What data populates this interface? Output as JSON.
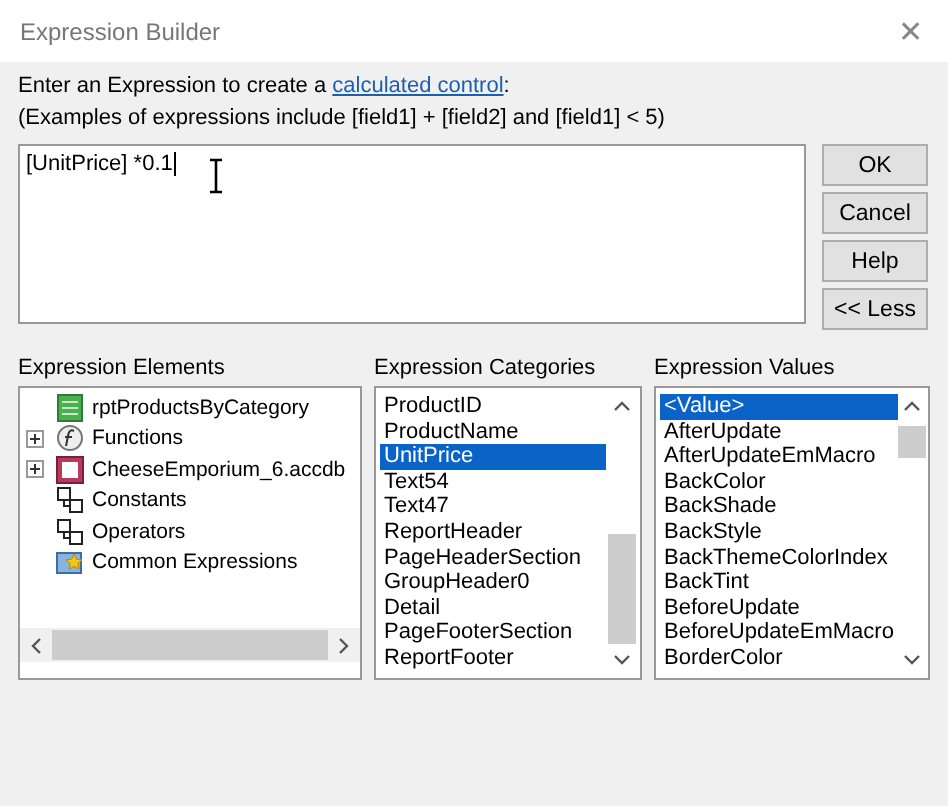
{
  "window": {
    "title": "Expression Builder",
    "close": "✕"
  },
  "intro": {
    "text": "Enter an Expression to create a ",
    "link": "calculated control",
    "after": ":"
  },
  "examples": "(Examples of expressions include [field1] + [field2] and [field1] < 5)",
  "expression": {
    "value": "[UnitPrice] *0.1"
  },
  "buttons": [
    "OK",
    "Cancel",
    "Help",
    "<< Less"
  ],
  "elements": {
    "label": "Expression Elements",
    "items": [
      {
        "kind": "report",
        "label": "rptProductsByCategory",
        "selected": false
      },
      {
        "kind": "function",
        "label": "Functions",
        "expanded": false,
        "selected": false
      },
      {
        "kind": "database",
        "label": "CheeseEmporium_6.accdb",
        "expanded": false,
        "selected": false
      },
      {
        "kind": "constants",
        "label": "Constants",
        "selected": false
      },
      {
        "kind": "operators",
        "label": "Operators",
        "selected": false
      },
      {
        "kind": "common",
        "label": "Common Expressions",
        "selected": false
      }
    ]
  },
  "categories": {
    "label": "Expression Categories",
    "items": [
      {
        "label": "ProductID",
        "selected": false
      },
      {
        "label": "ProductName",
        "selected": false
      },
      {
        "label": "UnitPrice",
        "selected": true
      },
      {
        "label": "Text54",
        "selected": false
      },
      {
        "label": "Text47",
        "selected": false
      },
      {
        "label": "ReportHeader",
        "selected": false
      },
      {
        "label": "PageHeaderSection",
        "selected": false
      },
      {
        "label": "GroupHeader0",
        "selected": false
      },
      {
        "label": "Detail",
        "selected": false
      },
      {
        "label": "PageFooterSection",
        "selected": false
      },
      {
        "label": "ReportFooter",
        "selected": false
      }
    ]
  },
  "values": {
    "label": "Expression Values",
    "items": [
      {
        "label": "<Value>",
        "selected": true
      },
      {
        "label": "AfterUpdate",
        "selected": false
      },
      {
        "label": "AfterUpdateEmMacro",
        "selected": false
      },
      {
        "label": "BackColor",
        "selected": false
      },
      {
        "label": "BackShade",
        "selected": false
      },
      {
        "label": "BackStyle",
        "selected": false
      },
      {
        "label": "BackThemeColorIndex",
        "selected": false
      },
      {
        "label": "BackTint",
        "selected": false
      },
      {
        "label": "BeforeUpdate",
        "selected": false
      },
      {
        "label": "BeforeUpdateEmMacro",
        "selected": false
      },
      {
        "label": "BorderColor",
        "selected": false
      }
    ]
  }
}
